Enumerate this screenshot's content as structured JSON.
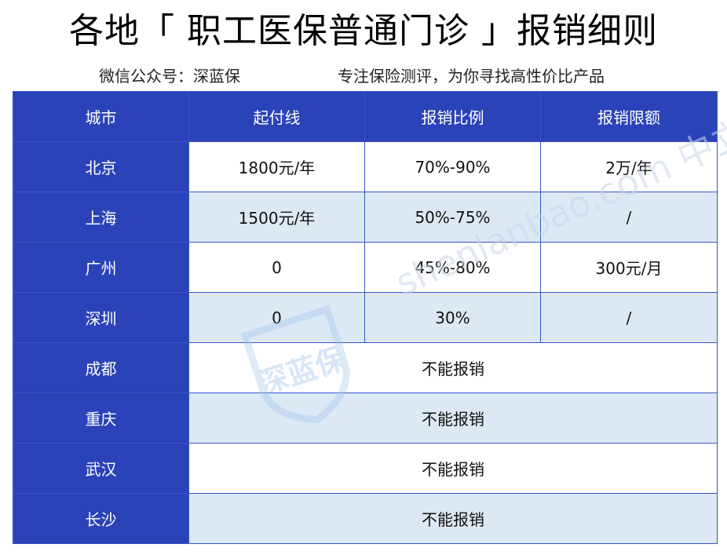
{
  "title": "各地「 职工医保普通门诊 」报销细则",
  "subtitle_left": "微信公众号：深蓝保",
  "subtitle_right": "专注保险测评，为你寻找高性价比产品",
  "watermark": {
    "logo_text": "深蓝保",
    "text": "shenlanbao.com 中立 | 专业 | 诚信"
  },
  "table": {
    "headers": [
      "城市",
      "起付线",
      "报销比例",
      "报销限额"
    ],
    "rows": [
      {
        "city": "北京",
        "threshold": "1800元/年",
        "ratio": "70%-90%",
        "limit": "2万/年"
      },
      {
        "city": "上海",
        "threshold": "1500元/年",
        "ratio": "50%-75%",
        "limit": "/"
      },
      {
        "city": "广州",
        "threshold": "0",
        "ratio": "45%-80%",
        "limit": "300元/月"
      },
      {
        "city": "深圳",
        "threshold": "0",
        "ratio": "30%",
        "limit": "/"
      }
    ],
    "na_rows": [
      {
        "city": "成都",
        "text": "不能报销"
      },
      {
        "city": "重庆",
        "text": "不能报销"
      },
      {
        "city": "武汉",
        "text": "不能报销"
      },
      {
        "city": "长沙",
        "text": "不能报销"
      }
    ]
  }
}
